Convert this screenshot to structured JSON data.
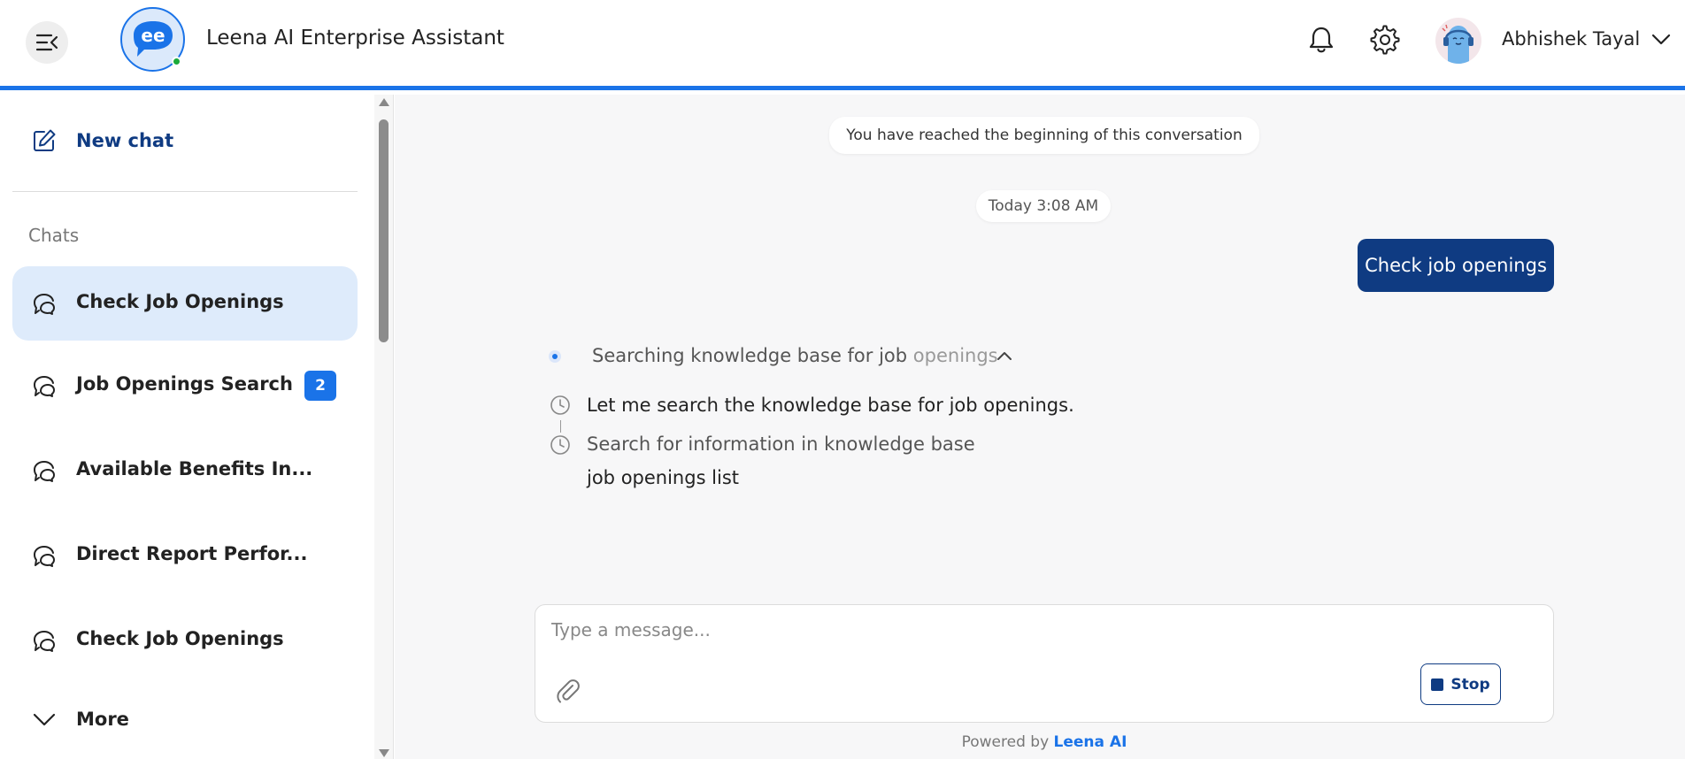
{
  "header": {
    "app_title": "Leena AI Enterprise Assistant",
    "user_name": "Abhishek Tayal",
    "icons": {
      "menu": "menu-collapse-icon",
      "notifications": "bell-icon",
      "settings": "gear-icon",
      "user_menu": "chevron-down-icon"
    }
  },
  "sidebar": {
    "new_chat_label": "New chat",
    "chats_heading": "Chats",
    "items": [
      {
        "label": "Check Job Openings",
        "active": true
      },
      {
        "label": "Job Openings Search",
        "badge": "2"
      },
      {
        "label": "Available Benefits In..."
      },
      {
        "label": "Direct Report Perfor..."
      },
      {
        "label": "Check Job Openings"
      }
    ],
    "more_label": "More"
  },
  "conversation": {
    "beginning_notice": "You have reached the beginning of this conversation",
    "timestamp": "Today 3:08 AM",
    "user_message": "Check job openings",
    "status": {
      "text_main": "Searching knowledge base for job ",
      "text_fade": "openings"
    },
    "steps": [
      {
        "text": "Let me search the knowledge base for job openings."
      },
      {
        "text": "Search for information in knowledge base"
      },
      {
        "text": "job openings list"
      }
    ]
  },
  "composer": {
    "placeholder": "Type a message...",
    "stop_label": "Stop"
  },
  "footer": {
    "powered_prefix": "Powered by ",
    "powered_brand": "Leena AI"
  },
  "colors": {
    "accent": "#1a73e8",
    "brand_dark": "#0f3b82",
    "active_item_bg": "#deebfb",
    "online": "#1bab3a"
  }
}
